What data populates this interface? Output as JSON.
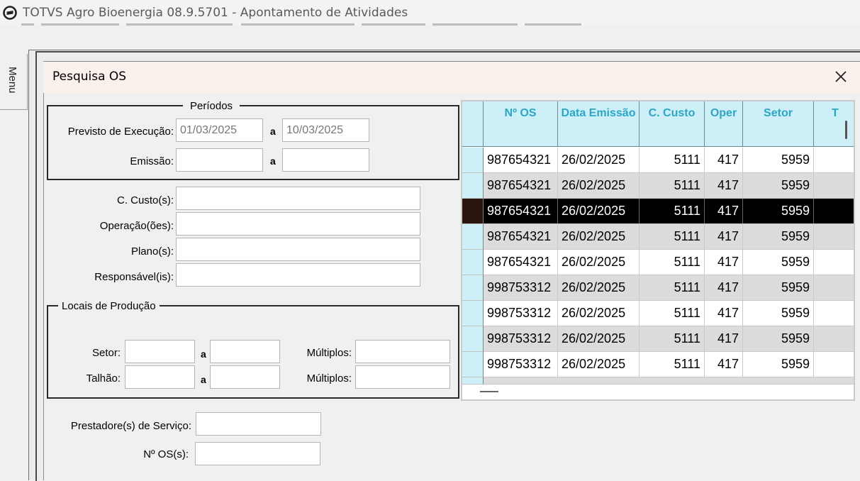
{
  "window": {
    "title": "TOTVS Agro Bioenergia 08.9.5701 - Apontamento de Atividades",
    "menu_label": "Menu"
  },
  "dialog": {
    "title": "Pesquisa OS",
    "close_label": "✕"
  },
  "periodos": {
    "legend": "Períodos",
    "previsto_label": "Previsto de Execução:",
    "previsto_from": "01/03/2025",
    "previsto_to": "10/03/2025",
    "emissao_label": "Emissão:",
    "emissao_from": "",
    "emissao_to": "",
    "a": "a"
  },
  "filters": {
    "ccusto_label": "C. Custo(s):",
    "operacao_label": "Operação(ões):",
    "plano_label": "Plano(s):",
    "responsavel_label": "Responsável(is):"
  },
  "locais": {
    "legend": "Locais de Produção",
    "setor_label": "Setor:",
    "talhao_label": "Talhão:",
    "multiplos_label": "Múltiplos:",
    "a": "a"
  },
  "bottom": {
    "prestadores_label": "Prestadore(s) de Serviço:",
    "nos_label": "Nº OS(s):"
  },
  "grid": {
    "columns": [
      "Nº OS",
      "Data Emissão",
      "C. Custo",
      "Oper",
      "Setor",
      "T"
    ],
    "selected_row": 2,
    "rows": [
      [
        "987654321",
        "26/02/2025",
        "5111",
        "417",
        "5959"
      ],
      [
        "987654321",
        "26/02/2025",
        "5111",
        "417",
        "5959"
      ],
      [
        "987654321",
        "26/02/2025",
        "5111",
        "417",
        "5959"
      ],
      [
        "987654321",
        "26/02/2025",
        "5111",
        "417",
        "5959"
      ],
      [
        "987654321",
        "26/02/2025",
        "5111",
        "417",
        "5959"
      ],
      [
        "998753312",
        "26/02/2025",
        "5111",
        "417",
        "5959"
      ],
      [
        "998753312",
        "26/02/2025",
        "5111",
        "417",
        "5959"
      ],
      [
        "998753312",
        "26/02/2025",
        "5111",
        "417",
        "5959"
      ],
      [
        "998753312",
        "26/02/2025",
        "5111",
        "417",
        "5959"
      ]
    ]
  },
  "colors": {
    "header_bg": "#cdeff7",
    "header_text": "#2ba6c9",
    "selected_row": "#000000",
    "dialog_title_bg": "#fbf1ec"
  }
}
